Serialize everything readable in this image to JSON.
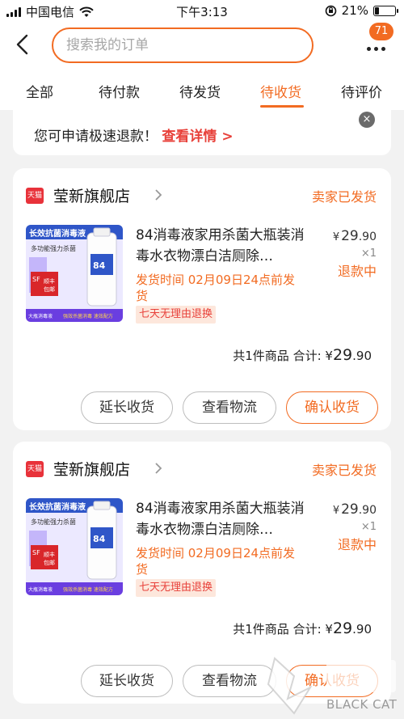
{
  "status_bar": {
    "carrier": "中国电信",
    "time": "下午3:13",
    "battery_percent": "21%",
    "battery_level": 0.21
  },
  "header": {
    "search_placeholder": "搜索我的订单",
    "message_badge": "71"
  },
  "tabs": [
    {
      "label": "全部",
      "active": false
    },
    {
      "label": "待付款",
      "active": false
    },
    {
      "label": "待发货",
      "active": false
    },
    {
      "label": "待收货",
      "active": true
    },
    {
      "label": "待评价",
      "active": false
    }
  ],
  "notice": {
    "text": "您可申请极速退款！",
    "link": "查看详情 >",
    "close": "×"
  },
  "orders": [
    {
      "shop_badge": "天猫",
      "shop_name": "莹新旗舰店",
      "status": "卖家已发货",
      "product_title": "84消毒液家用杀菌大瓶装消毒水衣物漂白洁厕除…",
      "price_symbol": "¥",
      "price_int": "29",
      "price_dec": ".90",
      "quantity": "×1",
      "refund_status": "退款中",
      "ship_time": "发货时间 02月09日24点前发货",
      "tag": "七天无理由退换",
      "summary_count": "共1件商品",
      "summary_label": "合计:",
      "summary_symbol": "¥",
      "summary_int": "29",
      "summary_dec": ".90",
      "buttons": [
        "延长收货",
        "查看物流",
        "确认收货"
      ]
    },
    {
      "shop_badge": "天猫",
      "shop_name": "莹新旗舰店",
      "status": "卖家已发货",
      "product_title": "84消毒液家用杀菌大瓶装消毒水衣物漂白洁厕除…",
      "price_symbol": "¥",
      "price_int": "29",
      "price_dec": ".90",
      "quantity": "×1",
      "refund_status": "退款中",
      "ship_time": "发货时间 02月09日24点前发货",
      "tag": "七天无理由退换",
      "summary_count": "共1件商品",
      "summary_label": "合计:",
      "summary_symbol": "¥",
      "summary_int": "29",
      "summary_dec": ".90",
      "buttons": [
        "延长收货",
        "查看物流",
        "确认收货"
      ]
    }
  ],
  "thumbnail": {
    "headline": "长效抗菌消毒液",
    "sub": "多功能强力杀菌",
    "badge_logo": "SF",
    "badge_line1": "顺丰",
    "badge_line2": "包邮",
    "bottom_left": "大瓶消毒液",
    "bottom_right": "强效杀菌消毒 速效配方"
  },
  "watermark": {
    "text": "BLACK CAT"
  },
  "colors": {
    "accent": "#f26b22",
    "red": "#e8413a",
    "tmall": "#e8323a"
  }
}
